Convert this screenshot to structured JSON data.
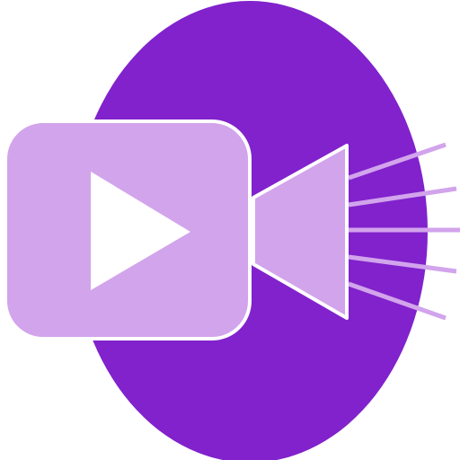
{
  "icon": {
    "name": "video-camera-icon",
    "colors": {
      "background": "#ffffff",
      "circle": "#8122cc",
      "camera_fill": "#d2a4ec",
      "outline": "#ffffff",
      "play_triangle": "#ffffff",
      "light_rays": "#d2a4ec"
    }
  }
}
